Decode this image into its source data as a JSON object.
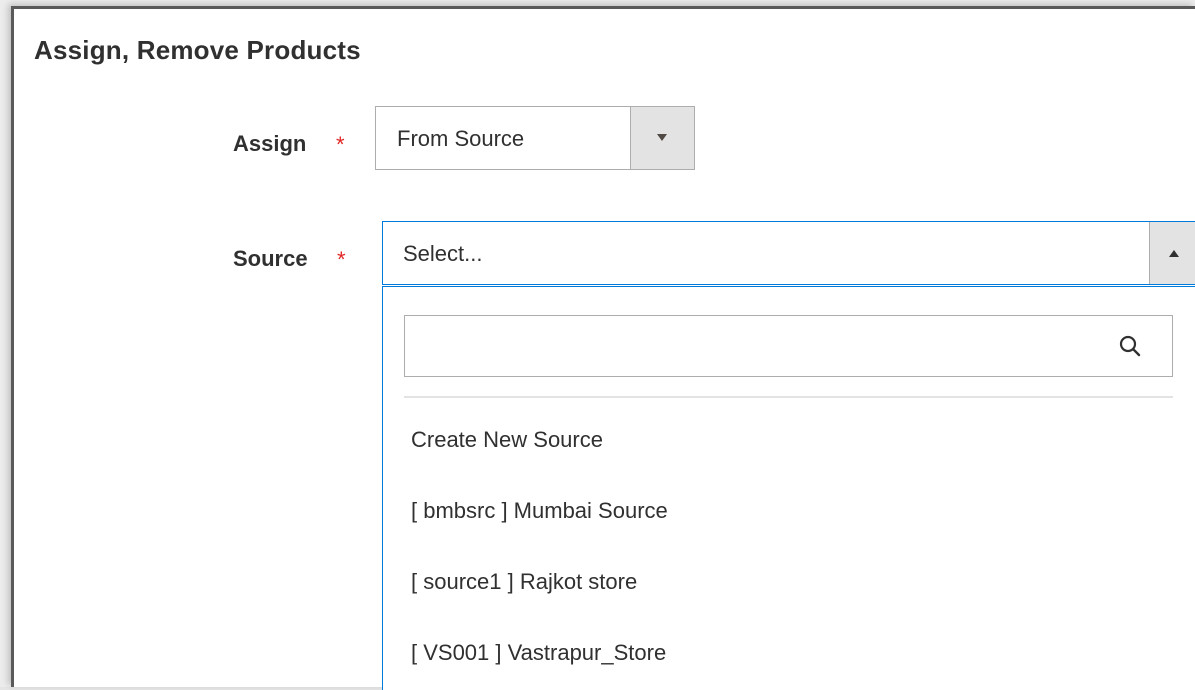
{
  "section": {
    "title": "Assign, Remove Products"
  },
  "assign": {
    "label": "Assign",
    "required_mark": "*",
    "selected_value": "From Source",
    "arrow_icon": "chevron-down-icon"
  },
  "source": {
    "label": "Source",
    "required_mark": "*",
    "placeholder": "Select...",
    "arrow_icon": "chevron-up-icon",
    "search_icon": "search-icon",
    "options": [
      {
        "label": "Create New Source"
      },
      {
        "label": "[ bmbsrc ] Mumbai Source"
      },
      {
        "label": "[ source1 ] Rajkot store"
      },
      {
        "label": "[ VS001 ] Vastrapur_Store"
      }
    ]
  },
  "colors": {
    "accent": "#007bdb",
    "required": "#e22626",
    "text": "#303030",
    "control_bg": "#e3e3e3"
  }
}
